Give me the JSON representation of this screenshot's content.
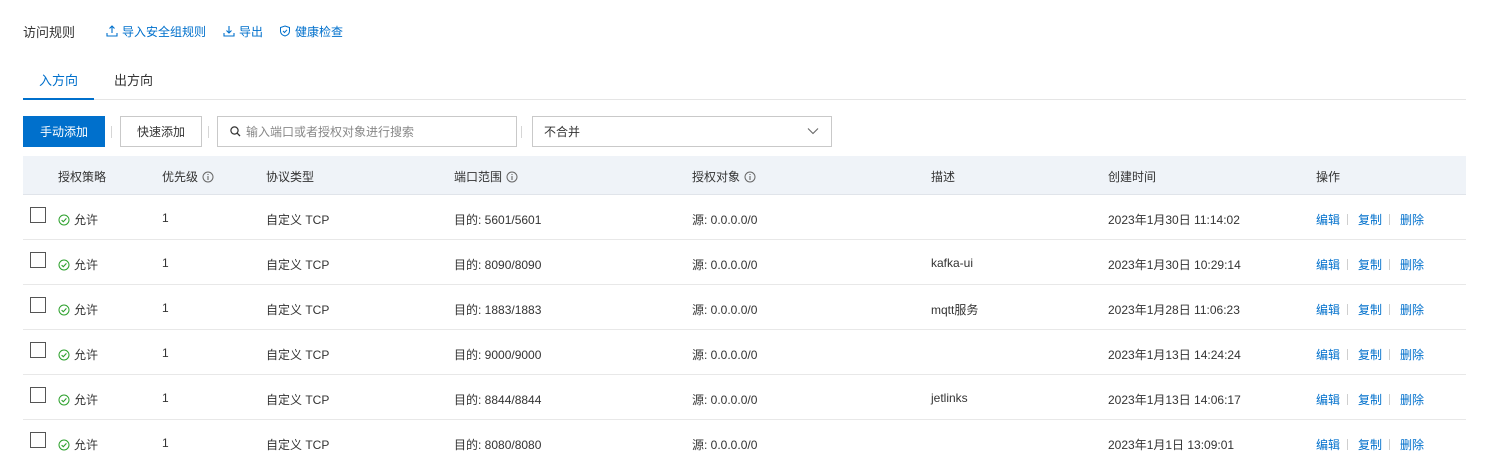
{
  "header": {
    "title": "访问规则",
    "import_label": "导入安全组规则",
    "export_label": "导出",
    "health_label": "健康检查"
  },
  "tabs": [
    {
      "label": "入方向",
      "active": true
    },
    {
      "label": "出方向",
      "active": false
    }
  ],
  "toolbar": {
    "manual_add": "手动添加",
    "quick_add": "快速添加",
    "search_placeholder": "输入端口或者授权对象进行搜索",
    "merge_select": "不合并"
  },
  "table": {
    "headers": {
      "policy": "授权策略",
      "priority": "优先级",
      "protocol": "协议类型",
      "port": "端口范围",
      "source": "授权对象",
      "desc": "描述",
      "created": "创建时间",
      "ops": "操作"
    },
    "rows": [
      {
        "policy": "允许",
        "priority": "1",
        "protocol": "自定义 TCP",
        "port": "目的: 5601/5601",
        "source": "源: 0.0.0.0/0",
        "desc": "",
        "created": "2023年1月30日 11:14:02"
      },
      {
        "policy": "允许",
        "priority": "1",
        "protocol": "自定义 TCP",
        "port": "目的: 8090/8090",
        "source": "源: 0.0.0.0/0",
        "desc": "kafka-ui",
        "created": "2023年1月30日 10:29:14"
      },
      {
        "policy": "允许",
        "priority": "1",
        "protocol": "自定义 TCP",
        "port": "目的: 1883/1883",
        "source": "源: 0.0.0.0/0",
        "desc": "mqtt服务",
        "created": "2023年1月28日 11:06:23"
      },
      {
        "policy": "允许",
        "priority": "1",
        "protocol": "自定义 TCP",
        "port": "目的: 9000/9000",
        "source": "源: 0.0.0.0/0",
        "desc": "",
        "created": "2023年1月13日 14:24:24"
      },
      {
        "policy": "允许",
        "priority": "1",
        "protocol": "自定义 TCP",
        "port": "目的: 8844/8844",
        "source": "源: 0.0.0.0/0",
        "desc": "jetlinks",
        "created": "2023年1月13日 14:06:17"
      },
      {
        "policy": "允许",
        "priority": "1",
        "protocol": "自定义 TCP",
        "port": "目的: 8080/8080",
        "source": "源: 0.0.0.0/0",
        "desc": "",
        "created": "2023年1月1日 13:09:01"
      }
    ],
    "actions": {
      "edit": "编辑",
      "copy": "复制",
      "delete": "删除"
    }
  },
  "colors": {
    "accent": "#0070cc",
    "allow_green": "#2ca02c",
    "header_bg": "#eff3f8"
  }
}
